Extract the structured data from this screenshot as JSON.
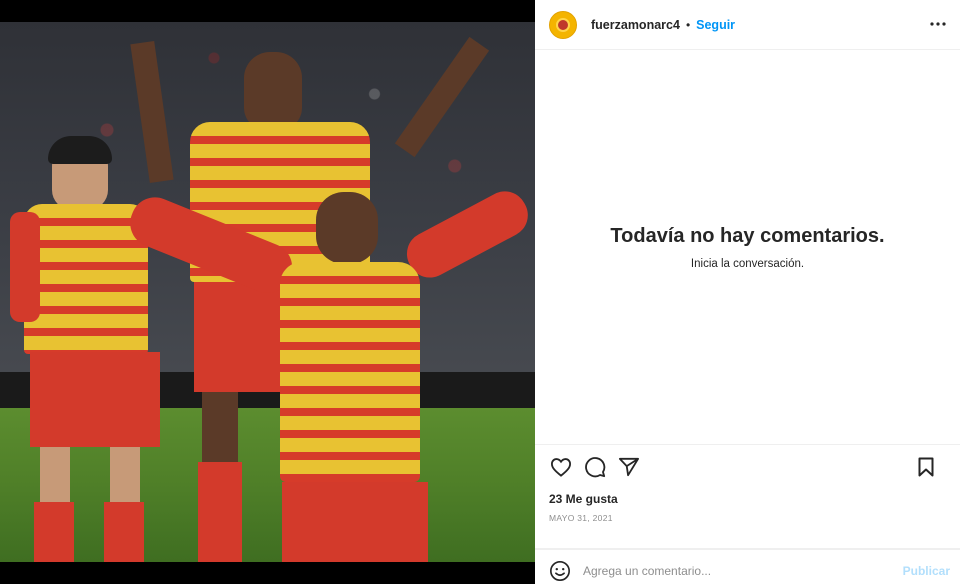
{
  "post": {
    "image_alt": "Jugadores de Monarcas celebrando un gol",
    "colors": {
      "shirt_yellow": "#e8c232",
      "shirt_red": "#d63b2a",
      "pitch_green": "#4f7f28"
    }
  },
  "header": {
    "username": "fuerzamonarc4",
    "separator": "•",
    "follow_label": "Seguir",
    "avatar_icon": "avatar-icon",
    "more_icon": "more-options-icon"
  },
  "comments": {
    "empty_title": "Todavía no hay comentarios.",
    "empty_subtitle": "Inicia la conversación."
  },
  "actions": {
    "like_icon": "heart-icon",
    "comment_icon": "comment-icon",
    "share_icon": "send-icon",
    "save_icon": "bookmark-icon"
  },
  "likes": {
    "text": "23 Me gusta"
  },
  "date": {
    "text": "MAYO 31, 2021"
  },
  "composer": {
    "placeholder": "Agrega un comentario...",
    "publish_label": "Publicar",
    "emoji_icon": "emoji-icon"
  },
  "accent_color": "#0095f6",
  "publish_disabled_color": "#b2dffc"
}
